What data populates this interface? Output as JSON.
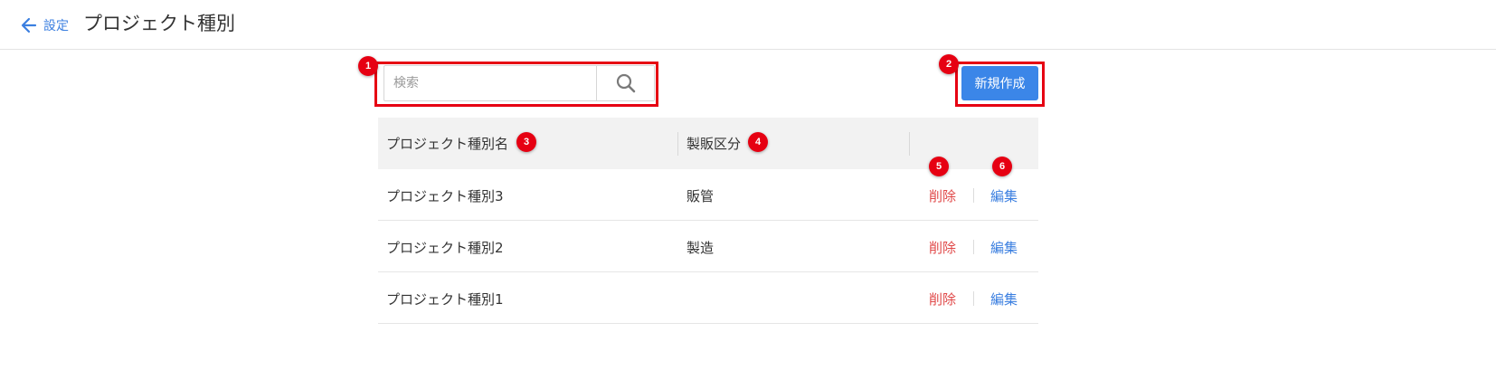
{
  "header": {
    "back_label": "設定",
    "title": "プロジェクト種別"
  },
  "search": {
    "placeholder": "検索",
    "value": ""
  },
  "create_button_label": "新規作成",
  "table": {
    "columns": [
      "プロジェクト種別名",
      "製販区分",
      ""
    ],
    "rows": [
      {
        "name": "プロジェクト種別3",
        "category": "販管",
        "delete_label": "削除",
        "edit_label": "編集"
      },
      {
        "name": "プロジェクト種別2",
        "category": "製造",
        "delete_label": "削除",
        "edit_label": "編集"
      },
      {
        "name": "プロジェクト種別1",
        "category": "",
        "delete_label": "削除",
        "edit_label": "編集"
      }
    ]
  },
  "annotations": [
    "1",
    "2",
    "3",
    "4",
    "5",
    "6"
  ],
  "colors": {
    "accent": "#3b86e8",
    "link": "#3b7fe0",
    "danger": "#e04848",
    "annotation": "#e60012"
  }
}
